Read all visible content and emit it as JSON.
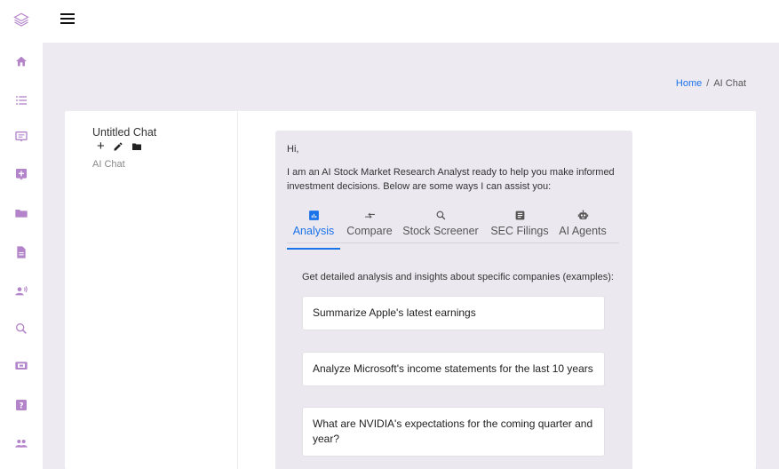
{
  "colors": {
    "accent": "#1a73e8",
    "rail_icon": "#b384c9",
    "content_bg": "#eeeaf1",
    "message_bg": "#ece8f0"
  },
  "rail": {
    "logo_icon": "layers-icon",
    "items": [
      {
        "icon": "home-icon"
      },
      {
        "icon": "list-icon"
      },
      {
        "icon": "chat-icon"
      },
      {
        "icon": "add-box-icon"
      },
      {
        "icon": "folder-icon"
      },
      {
        "icon": "document-icon"
      },
      {
        "icon": "speaker-person-icon"
      },
      {
        "icon": "search-icon"
      },
      {
        "icon": "screen-icon"
      },
      {
        "icon": "help-icon"
      },
      {
        "icon": "group-icon"
      }
    ]
  },
  "breadcrumb": {
    "home": "Home",
    "separator": "/",
    "current": "AI Chat"
  },
  "chat_list": {
    "title": "Untitled Chat",
    "add_label": "+",
    "subtitle": "AI Chat"
  },
  "message": {
    "greeting": "Hi,",
    "intro": "I am an AI Stock Market Research Analyst ready to help you make informed investment decisions. Below are some ways I can assist you:",
    "tabs": [
      {
        "label": "Analysis",
        "icon": "chart-icon",
        "active": true
      },
      {
        "label": "Compare",
        "icon": "compare-arrows-icon",
        "active": false
      },
      {
        "label": "Stock Screener",
        "icon": "search-icon",
        "active": false
      },
      {
        "label": "SEC Filings",
        "icon": "article-icon",
        "active": false
      },
      {
        "label": "AI Agents",
        "icon": "robot-icon",
        "active": false
      }
    ],
    "section_desc": "Get detailed analysis and insights about specific companies (examples):",
    "examples": [
      "Summarize Apple's latest earnings",
      "Analyze Microsoft's income statements for the last 10 years",
      "What are NVIDIA's expectations for the coming quarter and year?"
    ]
  }
}
